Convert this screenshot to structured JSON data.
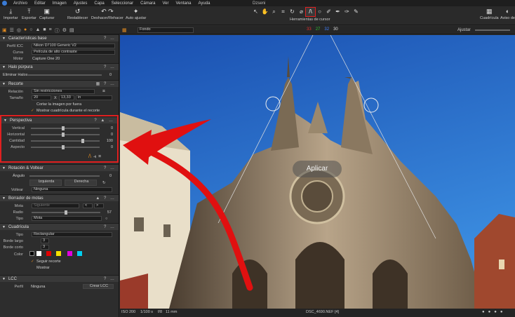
{
  "menu": [
    "Archivo",
    "Editar",
    "Imagen",
    "Ajustes",
    "Capa",
    "Seleccionar",
    "Cámara",
    "Ver",
    "Ventana",
    "Ayuda"
  ],
  "window_title": "Dzseni",
  "toolbar": {
    "importar": "Importar",
    "exportar": "Exportar",
    "capturar": "Capturar",
    "restablecer": "Restablecer",
    "deshacer": "Deshacer/Rehacer",
    "autoajustar": "Auto ajustar",
    "herramientas": "Herramientas de cursor",
    "cuadricula": "Cuadrícula",
    "aviso": "Aviso de"
  },
  "viewbar": {
    "fondo": "Fondo",
    "ajustar": "Ajustar",
    "c1": "33",
    "c2": "27",
    "c3": "32",
    "c4": "30"
  },
  "base": {
    "title": "Características base",
    "perfil_lab": "Perfil ICC",
    "perfil": "Nikon D7100 Generic V2",
    "curva_lab": "Curva",
    "curva": "Película de alto contraste",
    "motor_lab": "Motor",
    "motor": "Capture One 20"
  },
  "halo": {
    "title": "Halo púrpura",
    "lab": "Eliminar Halos",
    "val": "0"
  },
  "recorte": {
    "title": "Recorte",
    "rel_lab": "Relación",
    "rel": "Sin restricciones",
    "tam_lab": "Tamaño",
    "w": "20",
    "x": "X",
    "h": "13,33",
    "unit": "in",
    "cortar": "Cortar la imagen por fuera",
    "mostrar": "Mostrar cuadrícula durante el recorte"
  },
  "perspectiva": {
    "title": "Perspectiva",
    "vert_lab": "Vertical",
    "vert": "0",
    "hor_lab": "Horizontal",
    "hor": "0",
    "cant_lab": "Cantidad",
    "cant": "100",
    "asp_lab": "Aspecto",
    "asp": "0"
  },
  "rotacion": {
    "title": "Rotación & Voltear",
    "ang_lab": "Ángulo",
    "ang": "0",
    "izq": "Izquierda",
    "der": "Derecha",
    "volt_lab": "Voltear",
    "volt": "Ninguna"
  },
  "motas": {
    "title": "Borrador de motas",
    "mota_lab": "Mota",
    "mota": "Siguiente",
    "radio_lab": "Radio",
    "radio": "57",
    "tipo_lab": "Tipo",
    "tipo": "Mota"
  },
  "cuadricula": {
    "title": "Cuadrícula",
    "tipo_lab": "Tipo",
    "tipo": "Rectangular",
    "largo_lab": "Borde largo",
    "largo": "3",
    "corto_lab": "Borde corto",
    "corto": "3",
    "color_lab": "Color",
    "seguir": "Seguir recorte",
    "mostrar": "Mostrar"
  },
  "lcc": {
    "title": "LCC",
    "perfil_lab": "Perfil",
    "perfil": "Ninguna",
    "btn": "Crear LCC"
  },
  "photo": {
    "aplicar": "Aplicar"
  },
  "status": {
    "iso": "ISO 200",
    "speed": "1/100 s",
    "f": "f/8",
    "mm": "11 mm",
    "file": "DSC_4690.NEF [4]"
  },
  "colors": {
    "accent": "#e02020",
    "sky": "#2a6fc7",
    "red": "#e00000",
    "yellow": "#f5e000",
    "magenta": "#e000e0",
    "cyan": "#00d0f0"
  }
}
